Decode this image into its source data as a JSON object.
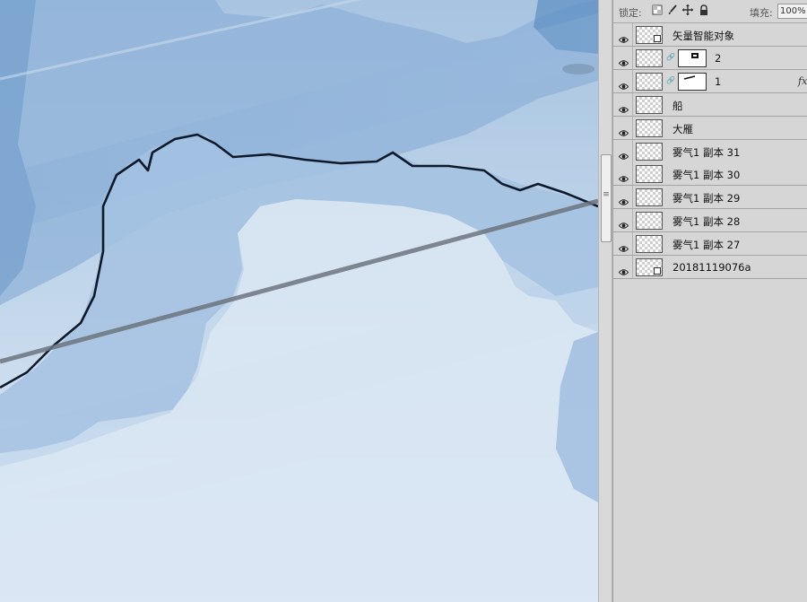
{
  "panel": {
    "lock_label": "锁定:",
    "fill_label": "填充:",
    "fill_value": "100%",
    "lock_icons": [
      "lock-transparent-icon",
      "lock-brush-icon",
      "lock-move-icon",
      "lock-all-icon"
    ]
  },
  "layers": [
    {
      "name": "矢量智能对象",
      "kind": "smart-object",
      "visible": true
    },
    {
      "name": "2",
      "kind": "masked",
      "visible": true
    },
    {
      "name": "1",
      "kind": "masked",
      "visible": true,
      "fx": "fx"
    },
    {
      "name": "船",
      "kind": "plain",
      "visible": true
    },
    {
      "name": "大雁",
      "kind": "plain",
      "visible": true
    },
    {
      "name": "雾气1 副本 31",
      "kind": "plain",
      "visible": true
    },
    {
      "name": "雾气1 副本 30",
      "kind": "plain",
      "visible": true
    },
    {
      "name": "雾气1 副本 29",
      "kind": "plain",
      "visible": true
    },
    {
      "name": "雾气1 副本 28",
      "kind": "plain",
      "visible": true
    },
    {
      "name": "雾气1 副本 27",
      "kind": "plain",
      "visible": true
    },
    {
      "name": "20181119076a",
      "kind": "smart-object",
      "visible": true
    }
  ],
  "colors": {
    "canvas_light": "#dbe8f4",
    "canvas_mid": "#a9c5e2",
    "canvas_dark": "#6f9cc8",
    "ink_line": "#0d1a2c",
    "panel_bg": "#d6d6d6"
  }
}
